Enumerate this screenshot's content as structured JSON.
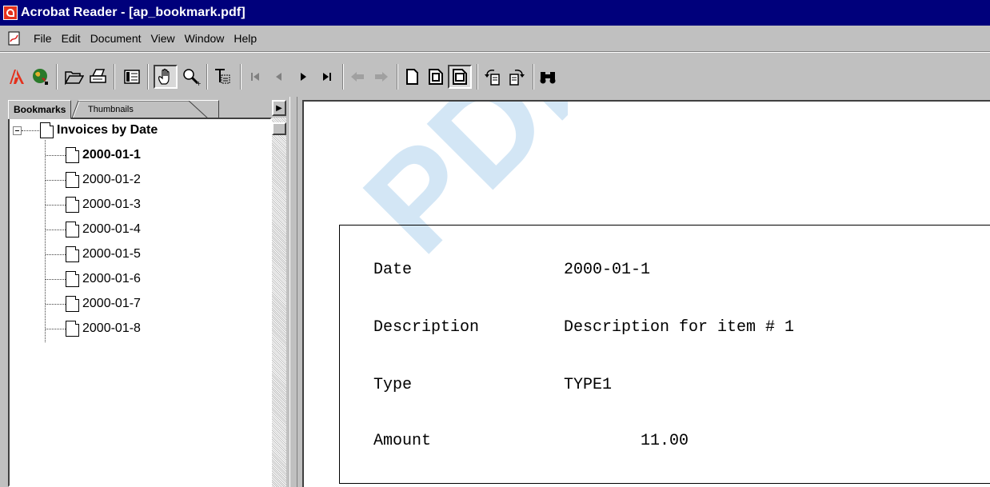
{
  "window": {
    "title": "Acrobat Reader - [ap_bookmark.pdf]"
  },
  "menu": [
    "File",
    "Edit",
    "Document",
    "View",
    "Window",
    "Help"
  ],
  "panel": {
    "tabs": {
      "bookmarks": "Bookmarks",
      "thumbnails": "Thumbnails"
    },
    "root": "Invoices by Date",
    "items": [
      "2000-01-1",
      "2000-01-2",
      "2000-01-3",
      "2000-01-4",
      "2000-01-5",
      "2000-01-6",
      "2000-01-7",
      "2000-01-8"
    ],
    "selected_item": "2000-01-1"
  },
  "document": {
    "watermark": "PDF",
    "fields": [
      {
        "label": "Date",
        "value": "2000-01-1"
      },
      {
        "label": "Description",
        "value": "Description for item # 1"
      },
      {
        "label": "Type",
        "value": "TYPE1"
      },
      {
        "label": "Amount",
        "value": "11.00"
      }
    ]
  },
  "colors": {
    "titlebar": "#00007b",
    "chrome": "#c0c0c0",
    "watermark": "#3b8fd6"
  }
}
